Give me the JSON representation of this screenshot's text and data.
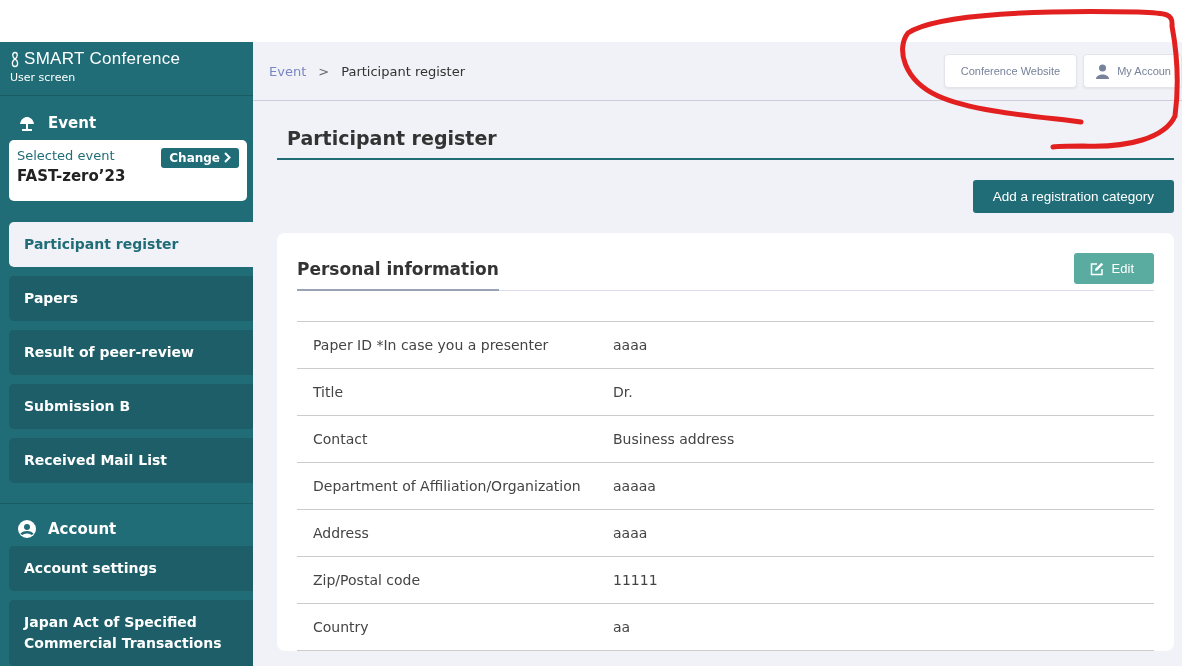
{
  "sidebar": {
    "brand": "SMART Conference",
    "subtitle": "User screen",
    "event_section": {
      "title": "Event",
      "selected_label": "Selected event",
      "selected_event": "FAST-zero’23",
      "change_button": "Change"
    },
    "items": [
      {
        "label": "Participant register",
        "selected": true
      },
      {
        "label": "Papers",
        "selected": false
      },
      {
        "label": "Result of peer-review",
        "selected": false
      },
      {
        "label": "Submission B",
        "selected": false
      },
      {
        "label": "Received Mail List",
        "selected": false
      }
    ],
    "account_section": {
      "title": "Account",
      "items": [
        {
          "label": "Account settings",
          "selected": false
        },
        {
          "label": "Japan Act of Specified Commercial Transactions",
          "selected": false
        }
      ]
    }
  },
  "topbar": {
    "breadcrumb": [
      "Event",
      "Participant register"
    ],
    "separator": ">",
    "buttons": [
      {
        "label": "Conference Website",
        "kind": "plain"
      },
      {
        "label": "My Accoun",
        "kind": "account"
      }
    ]
  },
  "page": {
    "title": "Participant register",
    "add_button": "Add a registration category"
  },
  "card": {
    "title": "Personal information",
    "edit_button": "Edit",
    "rows": [
      {
        "label": "Paper ID *In case you a presenter",
        "value": "aaaa"
      },
      {
        "label": "Title",
        "value": "Dr."
      },
      {
        "label": "Contact",
        "value": "Business address"
      },
      {
        "label": "Department of Affiliation/Organization",
        "value": "aaaaa"
      },
      {
        "label": "Address",
        "value": "aaaa"
      },
      {
        "label": "Zip/Postal code",
        "value": "11111"
      },
      {
        "label": "Country",
        "value": "aa"
      }
    ]
  }
}
